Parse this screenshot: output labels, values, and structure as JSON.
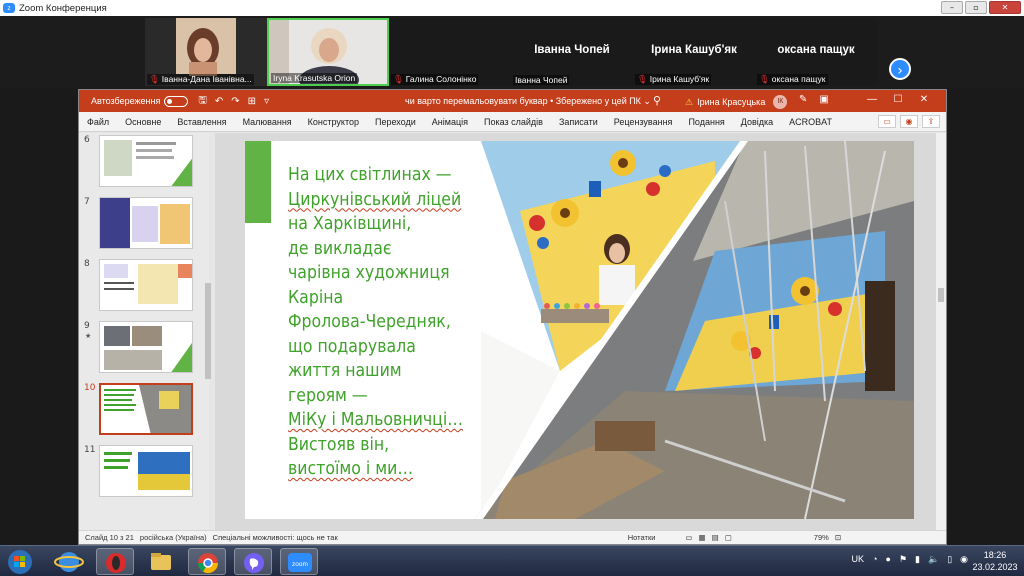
{
  "zoom": {
    "title": "Zoom Конференция"
  },
  "participants": [
    {
      "name": "Іванна-Дана Іванівна..."
    },
    {
      "name": "Iryna Krasutska Orion"
    },
    {
      "name": "Галина Солонінко"
    },
    {
      "name": "Іванна Чопей",
      "big": "Іванна Чопей"
    },
    {
      "name": "Ірина Кашуб'як",
      "big": "Ірина Кашуб'як"
    },
    {
      "name": "оксана пащук",
      "big": "оксана пащук"
    }
  ],
  "ppt": {
    "autosave": "Автозбереження",
    "doc_title": "чи варто перемальовувати буквар • Збережено у цей ПК ⌄",
    "user_name": "Ірина Красуцька",
    "user_initials": "ІК",
    "menu": [
      "Файл",
      "Основне",
      "Вставлення",
      "Малювання",
      "Конструктор",
      "Переходи",
      "Анімація",
      "Показ слайдів",
      "Записати",
      "Рецензування",
      "Подання",
      "Довідка",
      "ACROBAT"
    ]
  },
  "thumbnails": [
    {
      "num": "6"
    },
    {
      "num": "7"
    },
    {
      "num": "8"
    },
    {
      "num": "9",
      "star": "★"
    },
    {
      "num": "10",
      "selected": true
    },
    {
      "num": "11"
    }
  ],
  "slide": {
    "lines": [
      "На цих світлинах —",
      "Циркунівський ліцей",
      "на Харківщині,",
      "де викладає",
      "чарівна художниця",
      "Каріна",
      "Фролова-Чередняк,",
      "що подарувала",
      "життя нашим",
      "героям —",
      "МіКу і Мальовничці…",
      "Вистояв він,",
      "вистоїмо і ми…"
    ]
  },
  "status": {
    "slide": "Слайд 10 з 21",
    "lang": "російська (Україна)",
    "access": "Спеціальні можливості: щось не так",
    "notes": "Нотатки",
    "zoom": "79%"
  },
  "taskbar": {
    "lang": "UK",
    "time": "18:26",
    "date": "23.02.2023"
  },
  "colors": {
    "ppt_accent": "#c43e1c",
    "slide_text": "#3fa22a",
    "zoom_blue": "#2D8CFF"
  }
}
